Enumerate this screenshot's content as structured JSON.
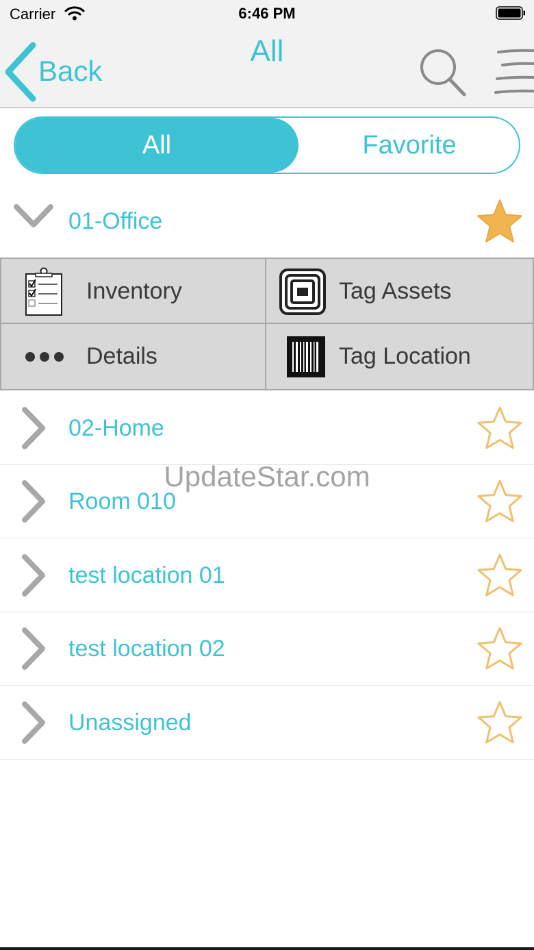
{
  "status_bar": {
    "carrier": "Carrier",
    "time": "6:46 PM"
  },
  "nav": {
    "back_label": "Back",
    "title": "All"
  },
  "segment": {
    "all_label": "All",
    "favorite_label": "Favorite",
    "selected": "All"
  },
  "expanded_location": {
    "label": "01-Office",
    "favorite": true
  },
  "actions": {
    "inventory": "Inventory",
    "tag_assets": "Tag Assets",
    "details": "Details",
    "tag_location": "Tag Location"
  },
  "locations": [
    {
      "label": "02-Home",
      "favorite": false
    },
    {
      "label": "Room 010",
      "favorite": false
    },
    {
      "label": "test location 01",
      "favorite": false
    },
    {
      "label": "test location 02",
      "favorite": false
    },
    {
      "label": "Unassigned",
      "favorite": false
    }
  ],
  "watermark": "UpdateStar.com",
  "colors": {
    "accent": "#3ec3d5",
    "star_filled": "#f0b450",
    "star_outline": "#f0c070",
    "chevron": "#a8a8a8"
  },
  "icons": {
    "back": "chevron-left-icon",
    "search": "search-icon",
    "menu": "menu-icon",
    "expanded": "chevron-down-icon",
    "collapsed": "chevron-right-icon",
    "favorite": "star-icon",
    "inventory": "clipboard-checklist-icon",
    "tag_assets": "rfid-tag-icon",
    "details": "more-dots-icon",
    "tag_location": "barcode-icon"
  }
}
